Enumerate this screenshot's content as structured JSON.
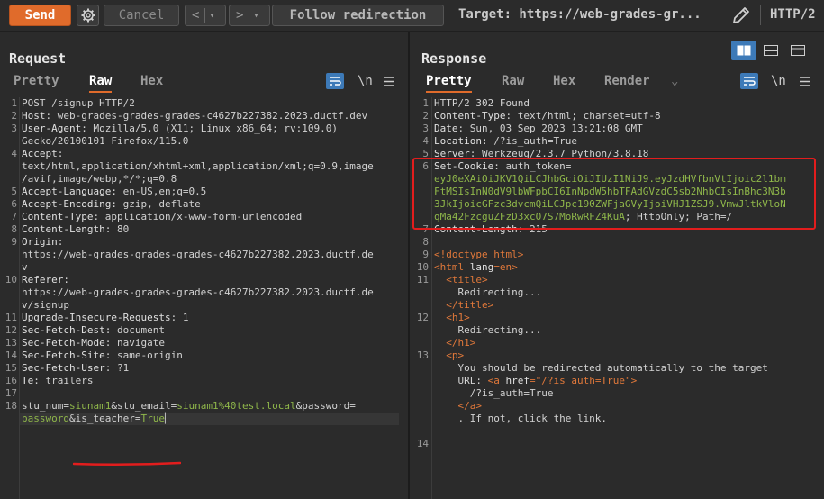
{
  "toolbar": {
    "send": "Send",
    "cancel": "Cancel",
    "back": "<",
    "forward": ">",
    "dropdown": "▾",
    "follow": "Follow redirection",
    "target": "Target: https://web-grades-gr...",
    "protocol": "HTTP/2"
  },
  "request": {
    "title": "Request",
    "tabs": [
      "Pretty",
      "Raw",
      "Hex"
    ],
    "active_tab": "Raw",
    "newline_icon": "\\n",
    "lines": [
      {
        "n": "1",
        "t": "POST /signup HTTP/2"
      },
      {
        "n": "2",
        "k": "Host",
        "v": "web-grades-grades-grades-c4627b227382.2023.ductf.dev"
      },
      {
        "n": "3",
        "k": "User-Agent",
        "v": "Mozilla/5.0 (X11; Linux x86_64; rv:109.0)"
      },
      {
        "n": "",
        "t": "Gecko/20100101 Firefox/115.0"
      },
      {
        "n": "4",
        "k": "Accept",
        "v": ""
      },
      {
        "n": "",
        "t": "text/html,application/xhtml+xml,application/xml;q=0.9,image"
      },
      {
        "n": "",
        "t": "/avif,image/webp,*/*;q=0.8"
      },
      {
        "n": "5",
        "k": "Accept-Language",
        "v": "en-US,en;q=0.5"
      },
      {
        "n": "6",
        "k": "Accept-Encoding",
        "v": "gzip, deflate"
      },
      {
        "n": "7",
        "k": "Content-Type",
        "v": "application/x-www-form-urlencoded"
      },
      {
        "n": "8",
        "k": "Content-Length",
        "v": "80"
      },
      {
        "n": "9",
        "k": "Origin",
        "v": ""
      },
      {
        "n": "",
        "t": "https://web-grades-grades-grades-c4627b227382.2023.ductf.de"
      },
      {
        "n": "",
        "t": "v"
      },
      {
        "n": "10",
        "k": "Referer",
        "v": ""
      },
      {
        "n": "",
        "t": "https://web-grades-grades-grades-c4627b227382.2023.ductf.de"
      },
      {
        "n": "",
        "t": "v/signup"
      },
      {
        "n": "11",
        "k": "Upgrade-Insecure-Requests",
        "v": "1"
      },
      {
        "n": "12",
        "k": "Sec-Fetch-Dest",
        "v": "document"
      },
      {
        "n": "13",
        "k": "Sec-Fetch-Mode",
        "v": "navigate"
      },
      {
        "n": "14",
        "k": "Sec-Fetch-Site",
        "v": "same-origin"
      },
      {
        "n": "15",
        "k": "Sec-Fetch-User",
        "v": "?1"
      },
      {
        "n": "16",
        "k": "Te",
        "v": "trailers"
      },
      {
        "n": "17",
        "t": ""
      },
      {
        "n": "18",
        "body1": true
      },
      {
        "n": "",
        "body2": true
      }
    ],
    "body": {
      "p1": "stu_num",
      "v1": "siunam1",
      "p2": "stu_email",
      "v2": "siunam1%40test.local",
      "p3": "password",
      "v3": "password",
      "p4": "is_teacher",
      "v4": "True"
    }
  },
  "response": {
    "title": "Response",
    "tabs": [
      "Pretty",
      "Raw",
      "Hex",
      "Render"
    ],
    "active_tab": "Pretty",
    "newline_icon": "\\n",
    "headers": [
      {
        "n": "1",
        "t": "HTTP/2 302 Found"
      },
      {
        "n": "2",
        "k": "Content-Type",
        "v": "text/html; charset=utf-8"
      },
      {
        "n": "3",
        "k": "Date",
        "v": "Sun, 03 Sep 2023 13:21:08 GMT"
      },
      {
        "n": "4",
        "k": "Location",
        "v": "/?is_auth=True"
      },
      {
        "n": "5",
        "k": "Server",
        "v": "Werkzeug/2.3.7 Python/3.8.18"
      },
      {
        "n": "6",
        "k": "Set-Cookie",
        "v": "auth_token="
      },
      {
        "n": "",
        "tok": "eyJ0eXAiOiJKV1QiLCJhbGciOiJIUzI1NiJ9.eyJzdHVfbnVtIjoic2l1bm"
      },
      {
        "n": "",
        "tok": "FtMSIsInN0dV9lbWFpbCI6InNpdW5hbTFAdGVzdC5sb2NhbCIsInBhc3N3b"
      },
      {
        "n": "",
        "tok": "3JkIjoicGFzc3dvcmQiLCJpc190ZWFjaGVyIjoiVHJ1ZSJ9.VmwJltkVloN"
      },
      {
        "n": "",
        "tok": "qMa42FzcguZFzD3xcO7S7MoRwRFZ4KuA",
        "rest": "; HttpOnly; Path=/"
      },
      {
        "n": "7",
        "k": "Content-Length",
        "v": "215"
      },
      {
        "n": "8",
        "t": ""
      }
    ],
    "html": [
      {
        "n": "9",
        "parts": [
          [
            "o",
            "<!doctype html>"
          ]
        ]
      },
      {
        "n": "10",
        "parts": [
          [
            "o",
            "<html "
          ],
          [
            "k",
            "lang"
          ],
          [
            "o",
            "="
          ],
          [
            "o",
            "en"
          ],
          [
            "o",
            ">"
          ]
        ]
      },
      {
        "n": "11",
        "parts": [
          [
            "t",
            "  "
          ],
          [
            "o",
            "<title>"
          ]
        ]
      },
      {
        "n": "",
        "parts": [
          [
            "t",
            "    Redirecting..."
          ]
        ]
      },
      {
        "n": "",
        "parts": [
          [
            "t",
            "  "
          ],
          [
            "o",
            "</title>"
          ]
        ]
      },
      {
        "n": "12",
        "parts": [
          [
            "t",
            "  "
          ],
          [
            "o",
            "<h1>"
          ]
        ]
      },
      {
        "n": "",
        "parts": [
          [
            "t",
            "    Redirecting..."
          ]
        ]
      },
      {
        "n": "",
        "parts": [
          [
            "t",
            "  "
          ],
          [
            "o",
            "</h1>"
          ]
        ]
      },
      {
        "n": "13",
        "parts": [
          [
            "t",
            "  "
          ],
          [
            "o",
            "<p>"
          ]
        ]
      },
      {
        "n": "",
        "parts": [
          [
            "t",
            "    You should be redirected automatically to the target"
          ]
        ]
      },
      {
        "n": "",
        "parts": [
          [
            "t",
            "    URL: "
          ],
          [
            "o",
            "<a "
          ],
          [
            "k",
            "href"
          ],
          [
            "o",
            "=\"/?is_auth=True\">"
          ]
        ]
      },
      {
        "n": "",
        "parts": [
          [
            "t",
            "      /?is_auth=True"
          ]
        ]
      },
      {
        "n": "",
        "parts": [
          [
            "t",
            "    "
          ],
          [
            "o",
            "</a>"
          ]
        ]
      },
      {
        "n": "",
        "parts": [
          [
            "t",
            "    . If not, click the link."
          ]
        ]
      },
      {
        "n": "",
        "parts": [
          [
            "t",
            ""
          ]
        ]
      },
      {
        "n": "14",
        "parts": [
          [
            "t",
            ""
          ]
        ]
      }
    ]
  },
  "colors": {
    "accent": "#e06b2b",
    "highlight": "#e21d1d",
    "value": "#8fb74a",
    "tag": "#e0783a"
  }
}
